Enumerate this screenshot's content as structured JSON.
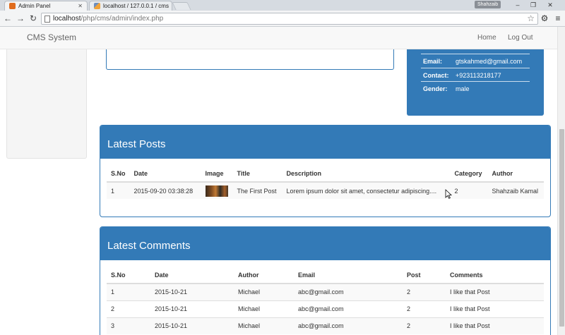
{
  "browser": {
    "tabs": [
      {
        "title": "Admin Panel",
        "active": true,
        "icon": "orange-page-icon"
      },
      {
        "title": "localhost / 127.0.0.1 / cms",
        "active": false,
        "icon": "phpmyadmin-icon"
      }
    ],
    "user_chip": "Shahzaib",
    "url_host": "localhost",
    "url_path": "/php/cms/admin/index.php"
  },
  "site": {
    "brand": "CMS System",
    "nav": {
      "home": "Home",
      "logout": "Log Out"
    }
  },
  "profile": {
    "rows": [
      {
        "label": "Email:",
        "value": "gtskahmed@gmail.com"
      },
      {
        "label": "Contact:",
        "value": "+923113218177"
      },
      {
        "label": "Gender:",
        "value": "male"
      }
    ]
  },
  "posts": {
    "title": "Latest Posts",
    "headers": {
      "sno": "S.No",
      "date": "Date",
      "image": "Image",
      "title": "Title",
      "description": "Description",
      "category": "Category",
      "author": "Author"
    },
    "rows": [
      {
        "sno": "1",
        "date": "2015-09-20 03:38:28",
        "title": "The First Post",
        "description": "Lorem ipsum dolor sit amet, consectetur adipiscing....",
        "category": "2",
        "author": "Shahzaib Kamal"
      }
    ]
  },
  "comments": {
    "title": "Latest Comments",
    "headers": {
      "sno": "S.No",
      "date": "Date",
      "author": "Author",
      "email": "Email",
      "post": "Post",
      "comments": "Comments"
    },
    "rows": [
      {
        "sno": "1",
        "date": "2015-10-21",
        "author": "Michael",
        "email": "abc@gmail.com",
        "post": "2",
        "comment": "I like that Post"
      },
      {
        "sno": "2",
        "date": "2015-10-21",
        "author": "Michael",
        "email": "abc@gmail.com",
        "post": "2",
        "comment": "I like that Post"
      },
      {
        "sno": "3",
        "date": "2015-10-21",
        "author": "Michael",
        "email": "abc@gmail.com",
        "post": "2",
        "comment": "I like that Post"
      }
    ]
  },
  "colors": {
    "primary": "#337ab7",
    "nav_bg": "#f8f8f8",
    "stripe": "#f9f9f9"
  }
}
